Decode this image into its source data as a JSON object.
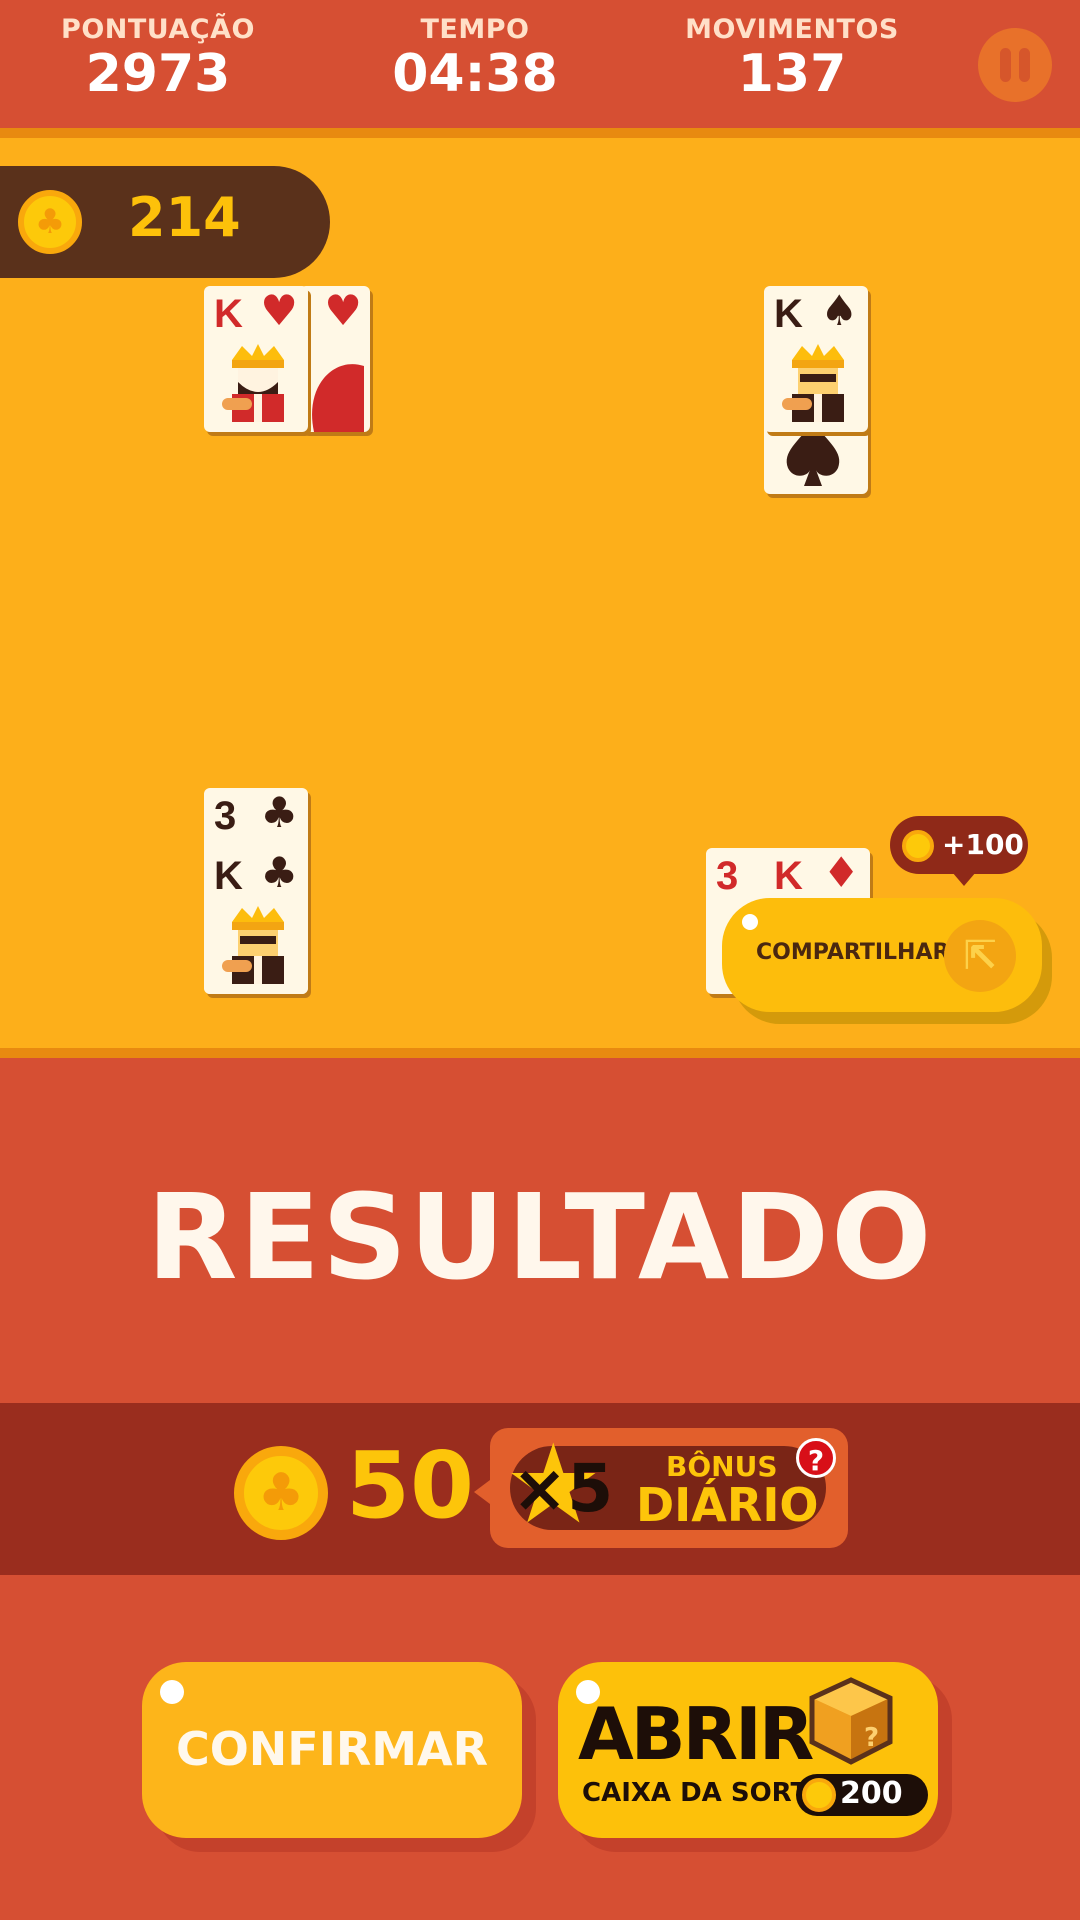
{
  "hud": {
    "score_label": "PONTUAÇÃO",
    "score": "2973",
    "time_label": "TEMPO",
    "time": "04:38",
    "moves_label": "MOVIMENTOS",
    "moves": "137"
  },
  "coins": {
    "balance": "214"
  },
  "foundations": [
    {
      "ranks": [
        "K",
        ""
      ],
      "suit": "♥",
      "color": "red"
    },
    {
      "ranks": [
        "K"
      ],
      "suit": "♠",
      "color": "dark"
    },
    {
      "ranks": [
        "3",
        "K"
      ],
      "suit": "♣",
      "color": "dark"
    },
    {
      "ranks": [
        "3",
        "K"
      ],
      "suit": "♦",
      "color": "red"
    }
  ],
  "share": {
    "bonus": "+100",
    "label": "COMPARTILHAR"
  },
  "result": {
    "title": "RESULTADO",
    "reward": "50",
    "multiplier": "×5",
    "bonus_line1": "BÔNUS",
    "bonus_line2": "DIÁRIO",
    "help": "?"
  },
  "buttons": {
    "confirm": "CONFIRMAR",
    "open_title": "ABRIR",
    "open_sub": "CAIXA DA SORTE",
    "open_price": "200"
  },
  "colors": {
    "header_bg": "#d64f33",
    "table_bg": "#fdaf1a",
    "coin": "#fdc90a",
    "band": "#9a2d1e"
  }
}
